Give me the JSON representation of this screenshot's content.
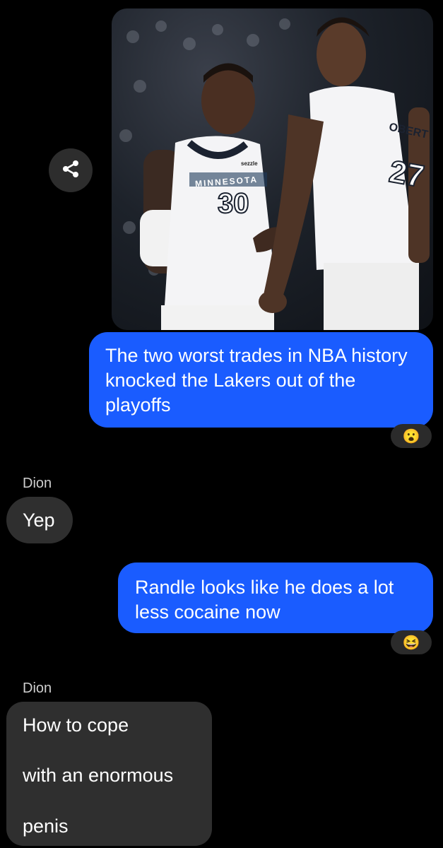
{
  "messages": {
    "m1": {
      "text": "The two worst trades in NBA history knocked the Lakers out of the playoffs",
      "reaction": "😮"
    },
    "m2": {
      "sender": "Dion",
      "text": "Yep"
    },
    "m3": {
      "text": "Randle looks like he does a lot less cocaine now",
      "reaction": "😆"
    },
    "m4": {
      "sender": "Dion",
      "lines": [
        "How to cope",
        "with an enormous",
        "penis"
      ]
    }
  },
  "photo": {
    "jersey_left_team": "MINNESOTA",
    "jersey_left_number": "30",
    "jersey_left_sponsor": "sezzle",
    "jersey_right_number": "27",
    "jersey_right_name": "OBERT"
  },
  "icons": {
    "share": "share-icon"
  },
  "colors": {
    "outgoing": "#1a5cff",
    "incoming": "#2f2f2f",
    "background": "#000000"
  }
}
